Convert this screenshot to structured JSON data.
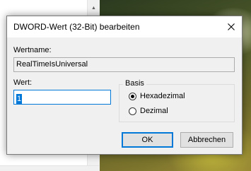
{
  "dialog": {
    "title": "DWORD-Wert (32-Bit) bearbeiten",
    "name_label": "Wertname:",
    "name_value": "RealTimeIsUniversal",
    "value_label": "Wert:",
    "value_value": "1",
    "base_group_label": "Basis",
    "base_options": [
      {
        "label": "Hexadezimal",
        "selected": true
      },
      {
        "label": "Dezimal",
        "selected": false
      }
    ],
    "ok_label": "OK",
    "cancel_label": "Abbrechen"
  },
  "colors": {
    "accent": "#0078d7",
    "dialog_bg": "#f0f0f0"
  },
  "icons": {
    "close": "close-icon"
  }
}
